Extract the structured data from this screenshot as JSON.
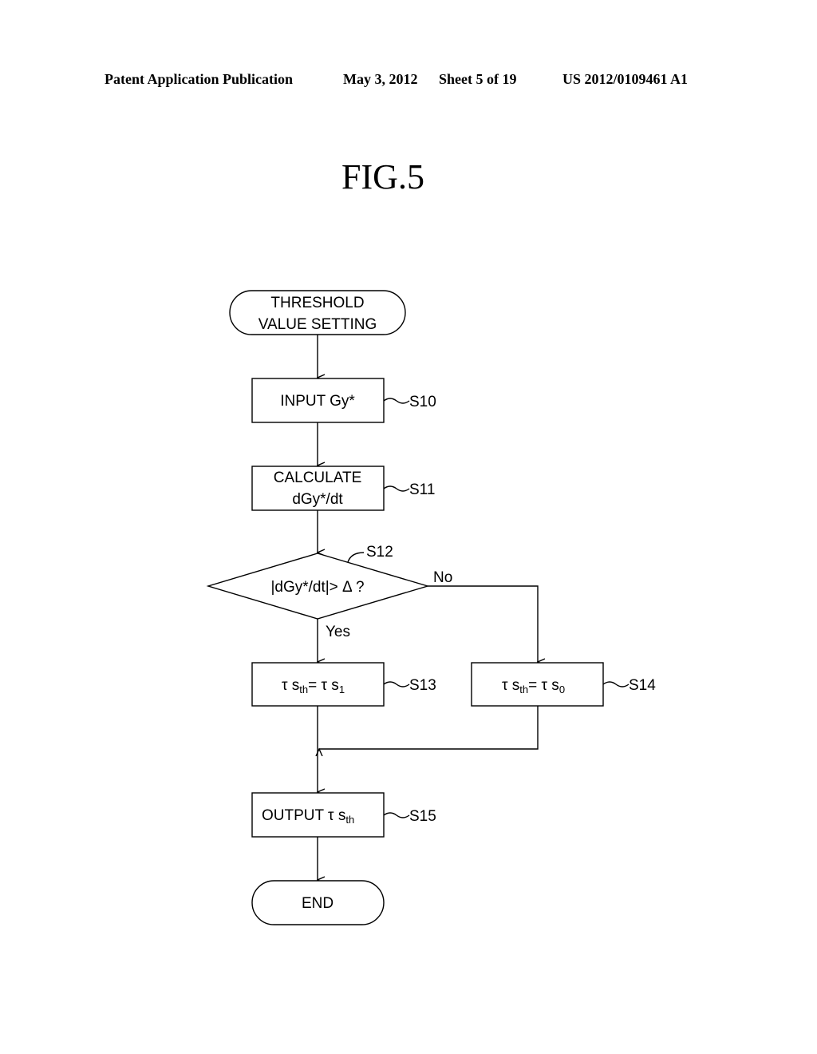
{
  "header": {
    "publication": "Patent Application Publication",
    "date": "May 3, 2012",
    "sheet": "Sheet 5 of 19",
    "number": "US 2012/0109461 A1"
  },
  "figure": {
    "title": "FIG.5"
  },
  "flowchart": {
    "start": {
      "line1": "THRESHOLD",
      "line2": "VALUE SETTING"
    },
    "s10": {
      "text": "INPUT Gy*",
      "step": "S10"
    },
    "s11": {
      "line1": "CALCULATE",
      "line2": "dGy*/dt",
      "step": "S11"
    },
    "s12": {
      "text": "|dGy*/dt|> Δ ?",
      "step": "S12",
      "yes": "Yes",
      "no": "No"
    },
    "s13": {
      "tau1": "τ s",
      "sub1": "th",
      "eq": "= τ s",
      "sub2": "1",
      "step": "S13"
    },
    "s14": {
      "tau1": "τ s",
      "sub1": "th",
      "eq": "= τ s",
      "sub2": "0",
      "step": "S14"
    },
    "s15": {
      "prefix": "OUTPUT  τ s",
      "sub": "th",
      "step": "S15"
    },
    "end": {
      "text": "END"
    }
  }
}
